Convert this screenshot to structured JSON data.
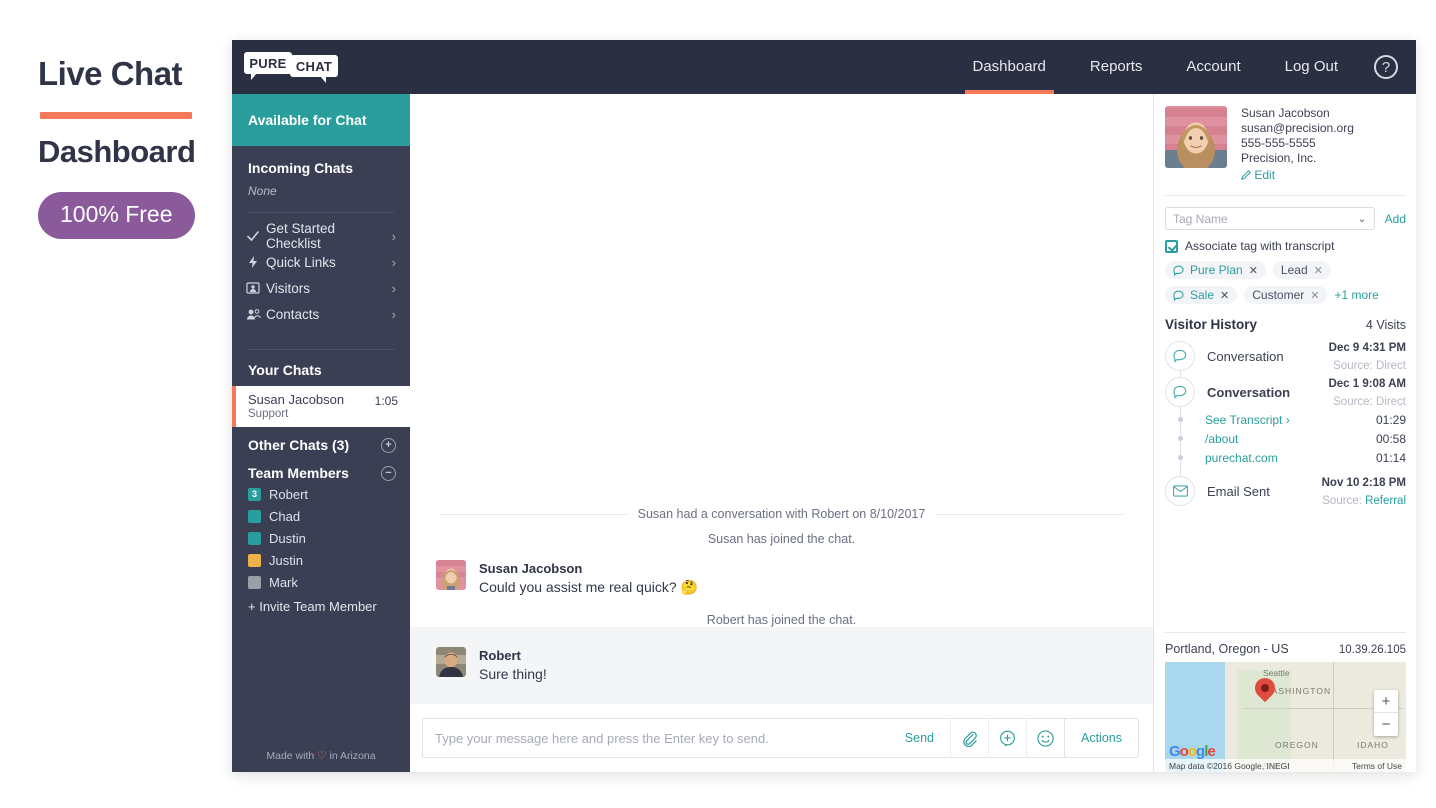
{
  "promo": {
    "title": "Live Chat",
    "subtitle": "Dashboard",
    "badge": "100% Free"
  },
  "topnav": {
    "logo_left": "PURE",
    "logo_right": "CHAT",
    "links": [
      {
        "label": "Dashboard",
        "active": true
      },
      {
        "label": "Reports",
        "active": false
      },
      {
        "label": "Account",
        "active": false
      },
      {
        "label": "Log Out",
        "active": false
      }
    ],
    "help_icon": "?"
  },
  "sidebar": {
    "status": "Available for Chat",
    "incoming_title": "Incoming Chats",
    "incoming_none": "None",
    "nav": [
      {
        "label": "Get Started Checklist",
        "icon": "check-icon"
      },
      {
        "label": "Quick Links",
        "icon": "bolt-icon"
      },
      {
        "label": "Visitors",
        "icon": "visitor-icon"
      },
      {
        "label": "Contacts",
        "icon": "contacts-icon"
      }
    ],
    "your_chats_title": "Your Chats",
    "active_chat": {
      "name": "Susan Jacobson",
      "role": "Support",
      "time": "1:05"
    },
    "other_chats": "Other Chats (3)",
    "team_members_title": "Team Members",
    "members": [
      {
        "name": "Robert",
        "color": "#2a9d9d",
        "badge": "3"
      },
      {
        "name": "Chad",
        "color": "#2a9d9d",
        "badge": ""
      },
      {
        "name": "Dustin",
        "color": "#2a9d9d",
        "badge": ""
      },
      {
        "name": "Justin",
        "color": "#f0b04a",
        "badge": ""
      },
      {
        "name": "Mark",
        "color": "#9a9ea9",
        "badge": ""
      }
    ],
    "invite": "+ Invite Team Member",
    "footer_pre": "Made with ",
    "footer_post": " in Arizona"
  },
  "chat": {
    "separator": "Susan had a conversation with Robert on 8/10/2017",
    "system_1": "Susan has joined the chat.",
    "system_2": "Robert has joined the chat.",
    "messages": [
      {
        "author": "Susan Jacobson",
        "text": "Could you assist me real quick? 🤔"
      },
      {
        "author": "Robert",
        "text": "Sure thing!"
      }
    ],
    "composer_placeholder": "Type your message here and press the Enter key to send.",
    "composer_value": "",
    "send_label": "Send",
    "actions_label": "Actions"
  },
  "right": {
    "contact": {
      "name": "Susan Jacobson",
      "email": "susan@precision.org",
      "phone": "555-555-5555",
      "company": "Precision, Inc.",
      "edit": "Edit"
    },
    "tag_placeholder": "Tag Name",
    "add_label": "Add",
    "associate_label": "Associate tag with transcript",
    "tags": [
      {
        "label": "Pure Plan",
        "teal": true
      },
      {
        "label": "Lead",
        "teal": false
      },
      {
        "label": "Sale",
        "teal": true
      },
      {
        "label": "Customer",
        "teal": false
      }
    ],
    "more_label": "+1 more",
    "history_title": "Visitor History",
    "visits": "4 Visits",
    "events": [
      {
        "label": "Conversation",
        "date": "Dec 9 4:31 PM",
        "source_pre": "Source: ",
        "source": "Direct",
        "bold": false,
        "icon": "chat-bubble-icon"
      },
      {
        "label": "Conversation",
        "date": "Dec 1 9:08 AM",
        "source_pre": "Source: ",
        "source": "Direct",
        "bold": true,
        "icon": "chat-bubble-icon"
      }
    ],
    "sub_events": [
      {
        "label": "See Transcript ›",
        "time": "01:29"
      },
      {
        "label": "/about",
        "time": "00:58"
      },
      {
        "label": "purechat.com",
        "time": "01:14"
      }
    ],
    "email_event": {
      "label": "Email Sent",
      "date": "Nov 10 2:18 PM",
      "source_pre": "Source: ",
      "source": "Referral",
      "icon": "envelope-icon"
    },
    "geo_city": "Portland, Oregon - US",
    "geo_ip": "10.39.26.105",
    "map": {
      "labels": [
        "Seattle",
        "WASHINGTON",
        "OREGON",
        "IDAHO",
        "Seattle"
      ],
      "zoom_in": "+",
      "zoom_out": "−",
      "attribution": "Map data ©2016 Google, INEGI",
      "terms": "Terms of Use",
      "watermark": [
        "G",
        "o",
        "o",
        "g",
        "l",
        "e"
      ]
    }
  },
  "colors": {
    "teal": "#2a9d9d",
    "orange": "#f4795b",
    "dark": "#2b2f42",
    "sidebar": "#3b3f54",
    "purple": "#8a5a9b"
  }
}
